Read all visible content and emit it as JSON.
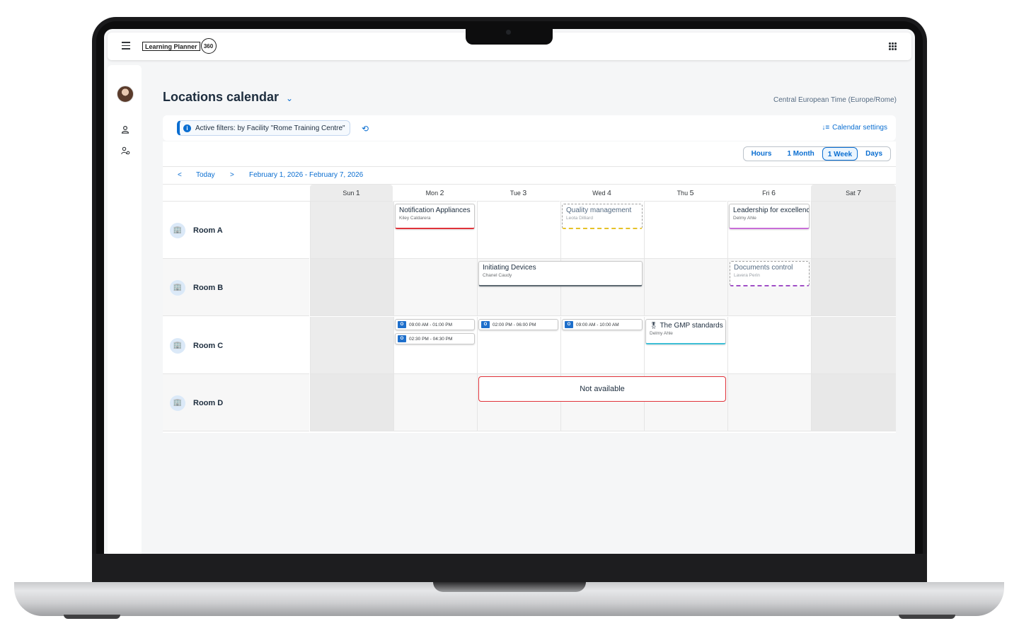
{
  "app": {
    "logo_text": "Learning Planner",
    "logo_badge": "360"
  },
  "page": {
    "title": "Locations calendar",
    "timezone": "Central European Time (Europe/Rome)"
  },
  "filter": {
    "chip": "Active filters: by Facility \"Rome Training Centre\"",
    "settings_label": "Calendar settings"
  },
  "view_modes": {
    "hours": "Hours",
    "month": "1 Month",
    "week": "1 Week",
    "days": "Days",
    "active": "1 Week"
  },
  "nav": {
    "prev": "<",
    "today": "Today",
    "next": ">",
    "range": "February 1, 2026 - February 7, 2026"
  },
  "days": [
    {
      "dow": "Sun",
      "num": "1",
      "weekend": true
    },
    {
      "dow": "Mon",
      "num": "2",
      "weekend": false
    },
    {
      "dow": "Tue",
      "num": "3",
      "weekend": false
    },
    {
      "dow": "Wed",
      "num": "4",
      "weekend": false
    },
    {
      "dow": "Thu",
      "num": "5",
      "weekend": false
    },
    {
      "dow": "Fri",
      "num": "6",
      "weekend": false
    },
    {
      "dow": "Sat",
      "num": "7",
      "weekend": true
    }
  ],
  "rooms": [
    "Room A",
    "Room B",
    "Room C",
    "Room D"
  ],
  "events": {
    "a_mon": {
      "title": "Notification Appliances",
      "sub": "Kiley Caldarera",
      "accent": "#e0333a"
    },
    "a_wed": {
      "title": "Quality management",
      "sub": "Leota Dilliard",
      "accent": "#e6c229"
    },
    "a_fri": {
      "title": "Leadership for excellence",
      "sub": "Delmy Ahle",
      "accent": "#c86dd7"
    },
    "b_tue": {
      "title": "Initiating Devices",
      "sub": "Chanel Caudy",
      "accent": "#5b6770"
    },
    "b_fri": {
      "title": "Documents control",
      "sub": "Lavera Perin",
      "accent": "#a04fc6"
    },
    "c_thu": {
      "title": "The GMP standards",
      "sub": "Delmy Ahle",
      "accent": "#3dbfd6"
    }
  },
  "slots": {
    "mon_1": "09:00 AM - 01:00 PM",
    "mon_2": "02:30 PM - 04:30 PM",
    "tue_1": "02:00 PM - 06:00 PM",
    "wed_1": "09:00 AM - 10:00 AM"
  },
  "not_available": "Not available",
  "icons": {
    "menu": "hamburger-icon",
    "apps": "grid-icon",
    "filter_info": "info-icon",
    "reset": "reset-icon",
    "settings": "sort-icon",
    "room": "building-icon",
    "outlook": "outlook-icon",
    "badge": "award-icon"
  }
}
